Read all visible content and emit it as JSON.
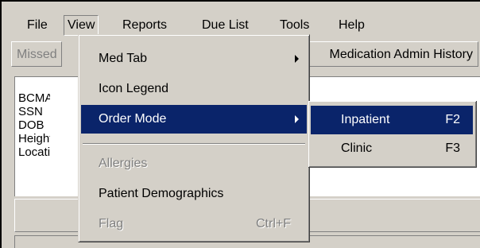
{
  "menubar": {
    "items": [
      {
        "label": "File"
      },
      {
        "label": "View"
      },
      {
        "label": "Reports"
      },
      {
        "label": "Due List"
      },
      {
        "label": "Tools"
      },
      {
        "label": "Help"
      }
    ]
  },
  "toolbar": {
    "missed_label": "Missed",
    "med_admin_label": "Medication Admin History"
  },
  "patient": {
    "labels": [
      "BCMA",
      "SSN",
      "DOB",
      "Height",
      "Location"
    ]
  },
  "view_menu": {
    "items": [
      {
        "label": "Med Tab",
        "shortcut": "",
        "submenu": true,
        "enabled": true
      },
      {
        "label": "Icon Legend",
        "shortcut": "",
        "submenu": false,
        "enabled": true
      },
      {
        "label": "Order Mode",
        "shortcut": "",
        "submenu": true,
        "enabled": true,
        "highlighted": true
      },
      {
        "label": "Allergies",
        "shortcut": "",
        "submenu": false,
        "enabled": false
      },
      {
        "label": "Patient Demographics",
        "shortcut": "",
        "submenu": false,
        "enabled": true
      },
      {
        "label": "Flag",
        "shortcut": "Ctrl+F",
        "submenu": false,
        "enabled": false
      }
    ]
  },
  "order_mode_submenu": {
    "items": [
      {
        "label": "Inpatient",
        "shortcut": "F2",
        "highlighted": true
      },
      {
        "label": "Clinic",
        "shortcut": "F3",
        "highlighted": false
      }
    ]
  },
  "colors": {
    "face": "#d4d0c8",
    "highlight": "#0a246a",
    "disabled_text": "#808080"
  }
}
